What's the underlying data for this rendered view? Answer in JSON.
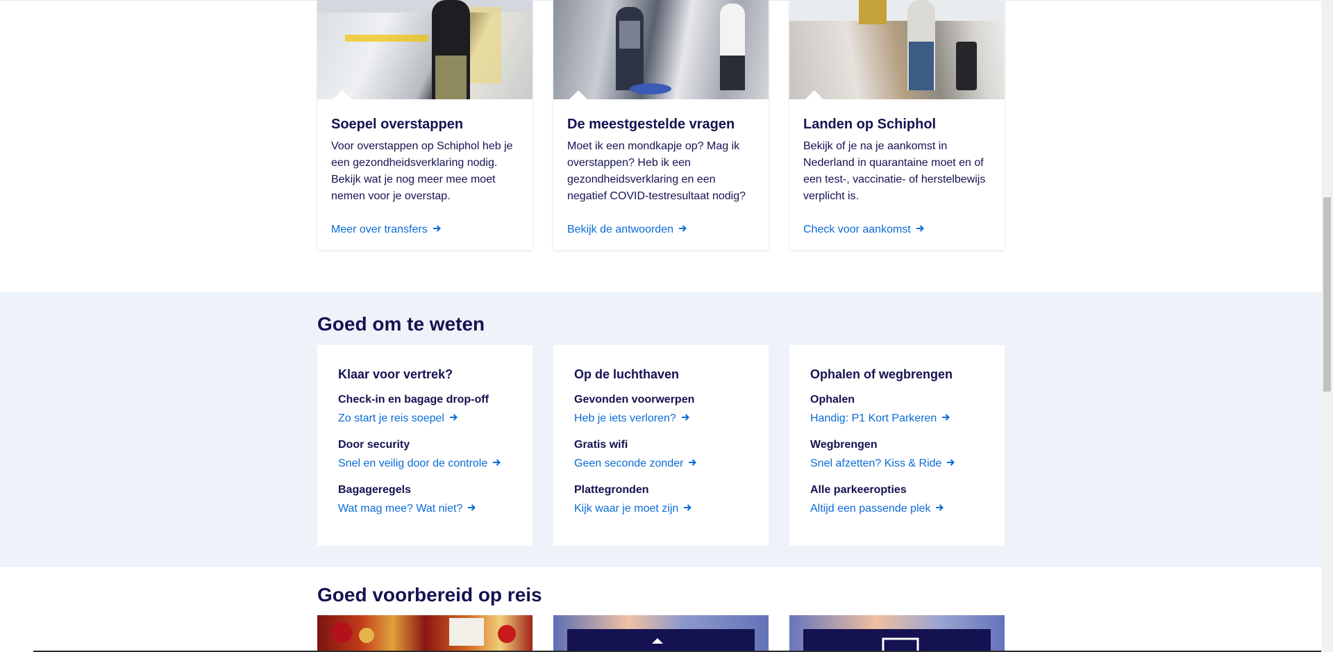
{
  "top_cards": [
    {
      "image": "traveller-at-kiosk-photo",
      "title": "Soepel overstappen",
      "text": "Voor overstappen op Schiphol heb je een gezondheidsverklaring nodig. Bekijk wat je nog meer mee moet nemen voor je overstap.",
      "link": "Meer over transfers"
    },
    {
      "image": "security-checkpoint-photo",
      "title": "De meestgestelde vragen",
      "text": "Moet ik een mondkapje op? Mag ik overstappen? Heb ik een gezondheidsverklaring en een negatief COVID-testresultaat nodig?",
      "link": "Bekijk de antwoorden"
    },
    {
      "image": "moving-walkway-photo",
      "title": "Landen op Schiphol",
      "text": "Bekijk of je na je aankomst in Nederland in quarantaine moet en of een test-, vaccinatie- of herstelbewijs verplicht is.",
      "link": "Check voor aankomst"
    }
  ],
  "know": {
    "heading": "Goed om te weten",
    "columns": [
      {
        "title": "Klaar voor vertrek?",
        "items": [
          {
            "title": "Check-in en bagage drop-off",
            "link": "Zo start je reis soepel"
          },
          {
            "title": "Door security",
            "link": "Snel en veilig door de controle"
          },
          {
            "title": "Bagageregels",
            "link": "Wat mag mee? Wat niet?"
          }
        ]
      },
      {
        "title": "Op de luchthaven",
        "items": [
          {
            "title": "Gevonden voorwerpen",
            "link": "Heb je iets verloren?"
          },
          {
            "title": "Gratis wifi",
            "link": "Geen seconde zonder"
          },
          {
            "title": "Plattegronden",
            "link": "Kijk waar je moet zijn"
          }
        ]
      },
      {
        "title": "Ophalen of wegbrengen",
        "items": [
          {
            "title": "Ophalen",
            "link": "Handig: P1 Kort Parkeren"
          },
          {
            "title": "Wegbrengen",
            "link": "Snel afzetten? Kiss & Ride"
          },
          {
            "title": "Alle parkeeropties",
            "link": "Altijd een passende plek"
          }
        ]
      }
    ]
  },
  "prepared": {
    "heading": "Goed voorbereid op reis",
    "images": [
      "christmas-decorations-photo",
      "illustration-upload-icon",
      "illustration-screen-icon"
    ]
  },
  "colors": {
    "navy": "#141251",
    "link_blue": "#0a6bd6",
    "section_bg": "#eef3fa"
  },
  "icons": {
    "link_arrow": "arrow-right-icon"
  }
}
